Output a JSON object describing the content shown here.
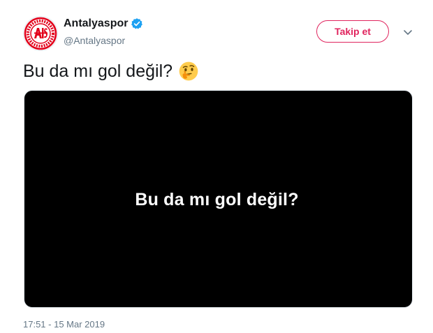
{
  "author": {
    "display_name": "Antalyaspor",
    "handle": "@Antalyaspor",
    "verified": true,
    "avatar_icon": "antalyaspor-logo-icon"
  },
  "follow_button": {
    "label": "Takip et"
  },
  "more_menu_icon": "chevron-down-icon",
  "tweet": {
    "text": "Bu da mı gol değil?",
    "emoji": "thinking-face-emoji"
  },
  "media": {
    "caption": "Bu da mı gol değil?"
  },
  "timestamp": "17:51 - 15 Mar 2019",
  "colors": {
    "accent": "#e0245e",
    "verified": "#1da1f2",
    "muted_text": "#657786",
    "text": "#14171a",
    "media_background": "#000000"
  }
}
